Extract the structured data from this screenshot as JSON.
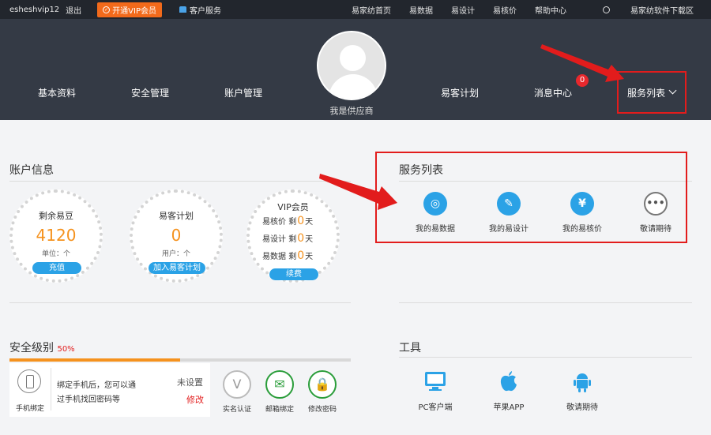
{
  "topbar": {
    "username": "esheshvip12",
    "logout": "退出",
    "vip_button": "开通VIP会员",
    "customer_service": "客户服务",
    "links": [
      "易家纺首页",
      "易数据",
      "易设计",
      "易核价",
      "帮助中心"
    ],
    "download": "易家纺软件下载区"
  },
  "nav": {
    "items": [
      "基本资料",
      "安全管理",
      "账户管理",
      "易客计划",
      "消息中心",
      "服务列表"
    ],
    "supplier_label": "我是供应商",
    "message_count": "0"
  },
  "account": {
    "title": "账户信息",
    "beans": {
      "label": "剩余易豆",
      "value": "4120",
      "unit": "单位：个",
      "button": "充值"
    },
    "plan": {
      "label": "易客计划",
      "value": "0",
      "unit": "用户：个",
      "button": "加入易客计划"
    },
    "vip": {
      "label": "VIP会员",
      "rows": [
        {
          "name": "易核价",
          "mid": "剩",
          "value": "0",
          "unit": "天"
        },
        {
          "name": "易设计",
          "mid": "剩",
          "value": "0",
          "unit": "天"
        },
        {
          "name": "易数据",
          "mid": "剩",
          "value": "0",
          "unit": "天"
        }
      ],
      "button": "续费"
    }
  },
  "services": {
    "title": "服务列表",
    "items": [
      "我的易数据",
      "我的易设计",
      "我的易核价",
      "敬请期待"
    ]
  },
  "security": {
    "title": "安全级别",
    "level": "50%",
    "progress": 0.5,
    "phone_text_1": "绑定手机后，您可以通",
    "phone_text_2": "过手机找回密码等",
    "phone_label": "手机绑定",
    "status": "未设置",
    "modify": "修改",
    "items": [
      "实名认证",
      "邮箱绑定",
      "修改密码"
    ]
  },
  "tools": {
    "title": "工具",
    "items": [
      "PC客户端",
      "苹果APP",
      "敬请期待"
    ]
  },
  "colors": {
    "accent": "#2ba2e6",
    "orange": "#f5921e",
    "highlight": "#e21c1c"
  }
}
